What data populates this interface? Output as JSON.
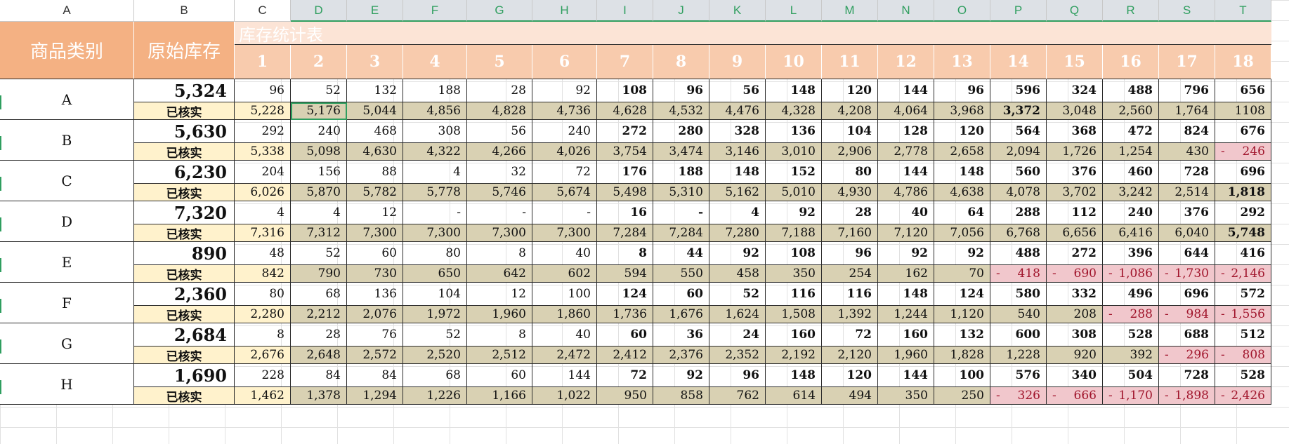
{
  "column_letters": [
    "A",
    "B",
    "C",
    "D",
    "E",
    "F",
    "G",
    "H",
    "I",
    "J",
    "K",
    "L",
    "M",
    "N",
    "O",
    "P",
    "Q",
    "R",
    "S",
    "T"
  ],
  "headers": {
    "category": "商品类别",
    "original_stock": "原始库存",
    "title": "库存统计表",
    "periods": [
      "1",
      "2",
      "3",
      "4",
      "5",
      "6",
      "7",
      "8",
      "9",
      "10",
      "11",
      "12",
      "13",
      "14",
      "15",
      "16",
      "17",
      "18"
    ]
  },
  "verified_label": "已核实",
  "rows": [
    {
      "category": "A",
      "original": "5,324",
      "daily": [
        "96",
        "52",
        "132",
        "188",
        "28",
        "92",
        "108",
        "96",
        "56",
        "148",
        "120",
        "144",
        "96",
        "596",
        "324",
        "488",
        "796",
        "656"
      ],
      "verified": [
        "5,228",
        "5,176",
        "5,044",
        "4,856",
        "4,828",
        "4,736",
        "4,628",
        "4,532",
        "4,476",
        "4,328",
        "4,208",
        "4,064",
        "3,968",
        "3,372",
        "3,048",
        "2,560",
        "1,764",
        "1108"
      ]
    },
    {
      "category": "B",
      "original": "5,630",
      "daily": [
        "292",
        "240",
        "468",
        "308",
        "56",
        "240",
        "272",
        "280",
        "328",
        "136",
        "104",
        "128",
        "120",
        "564",
        "368",
        "472",
        "824",
        "676"
      ],
      "verified": [
        "5,338",
        "5,098",
        "4,630",
        "4,322",
        "4,266",
        "4,026",
        "3,754",
        "3,474",
        "3,146",
        "3,010",
        "2,906",
        "2,778",
        "2,658",
        "2,094",
        "1,726",
        "1,254",
        "430",
        "246"
      ]
    },
    {
      "category": "C",
      "original": "6,230",
      "daily": [
        "204",
        "156",
        "88",
        "4",
        "32",
        "72",
        "176",
        "188",
        "148",
        "152",
        "80",
        "144",
        "148",
        "560",
        "376",
        "460",
        "728",
        "696"
      ],
      "verified": [
        "6,026",
        "5,870",
        "5,782",
        "5,778",
        "5,746",
        "5,674",
        "5,498",
        "5,310",
        "5,162",
        "5,010",
        "4,930",
        "4,786",
        "4,638",
        "4,078",
        "3,702",
        "3,242",
        "2,514",
        "1,818"
      ]
    },
    {
      "category": "D",
      "original": "7,320",
      "daily": [
        "4",
        "4",
        "12",
        "-",
        "-",
        "-",
        "16",
        "-",
        "4",
        "92",
        "28",
        "40",
        "64",
        "288",
        "112",
        "240",
        "376",
        "292"
      ],
      "verified": [
        "7,316",
        "7,312",
        "7,300",
        "7,300",
        "7,300",
        "7,300",
        "7,284",
        "7,284",
        "7,280",
        "7,188",
        "7,160",
        "7,120",
        "7,056",
        "6,768",
        "6,656",
        "6,416",
        "6,040",
        "5,748"
      ]
    },
    {
      "category": "E",
      "original": "890",
      "daily": [
        "48",
        "52",
        "60",
        "80",
        "8",
        "40",
        "8",
        "44",
        "92",
        "108",
        "96",
        "92",
        "92",
        "488",
        "272",
        "396",
        "644",
        "416"
      ],
      "verified": [
        "842",
        "790",
        "730",
        "650",
        "642",
        "602",
        "594",
        "550",
        "458",
        "350",
        "254",
        "162",
        "70",
        "418",
        "690",
        "1,086",
        "1,730",
        "2,146"
      ]
    },
    {
      "category": "F",
      "original": "2,360",
      "daily": [
        "80",
        "68",
        "136",
        "104",
        "12",
        "100",
        "124",
        "60",
        "52",
        "116",
        "116",
        "148",
        "124",
        "580",
        "332",
        "496",
        "696",
        "572"
      ],
      "verified": [
        "2,280",
        "2,212",
        "2,076",
        "1,972",
        "1,960",
        "1,860",
        "1,736",
        "1,676",
        "1,624",
        "1,508",
        "1,392",
        "1,244",
        "1,120",
        "540",
        "208",
        "288",
        "984",
        "1,556"
      ]
    },
    {
      "category": "G",
      "original": "2,684",
      "daily": [
        "8",
        "28",
        "76",
        "52",
        "8",
        "40",
        "60",
        "36",
        "24",
        "160",
        "72",
        "160",
        "132",
        "600",
        "308",
        "528",
        "688",
        "512"
      ],
      "verified": [
        "2,676",
        "2,648",
        "2,572",
        "2,520",
        "2,512",
        "2,472",
        "2,412",
        "2,376",
        "2,352",
        "2,192",
        "2,120",
        "1,960",
        "1,828",
        "1,228",
        "920",
        "392",
        "296",
        "808"
      ]
    },
    {
      "category": "H",
      "original": "1,690",
      "daily": [
        "228",
        "84",
        "84",
        "68",
        "60",
        "144",
        "72",
        "92",
        "96",
        "148",
        "120",
        "144",
        "100",
        "576",
        "340",
        "504",
        "728",
        "528"
      ],
      "verified": [
        "1,462",
        "1,378",
        "1,294",
        "1,226",
        "1,166",
        "1,022",
        "950",
        "858",
        "762",
        "614",
        "494",
        "350",
        "250",
        "326",
        "666",
        "1,170",
        "1,898",
        "2,426"
      ]
    }
  ],
  "negative_cells": {
    "B": [
      17
    ],
    "E": [
      13,
      14,
      15,
      16,
      17
    ],
    "F": [
      15,
      16,
      17
    ],
    "G": [
      16,
      17
    ],
    "H": [
      13,
      14,
      15,
      16,
      17
    ]
  },
  "bold_verified_cells": {
    "A": [
      13
    ],
    "C": [
      17
    ],
    "D": [
      17
    ]
  },
  "selected_cell": "D",
  "colors": {
    "header_dark": "#f4b183",
    "header_light": "#f8cbad",
    "title_fill": "#fce4d6",
    "verified_fill": "#d9d1b3",
    "verified_label_fill": "#fff2cc",
    "negative_fill": "#f1c7cc",
    "negative_text": "#a0142b",
    "selection": "#2f9e5f"
  }
}
